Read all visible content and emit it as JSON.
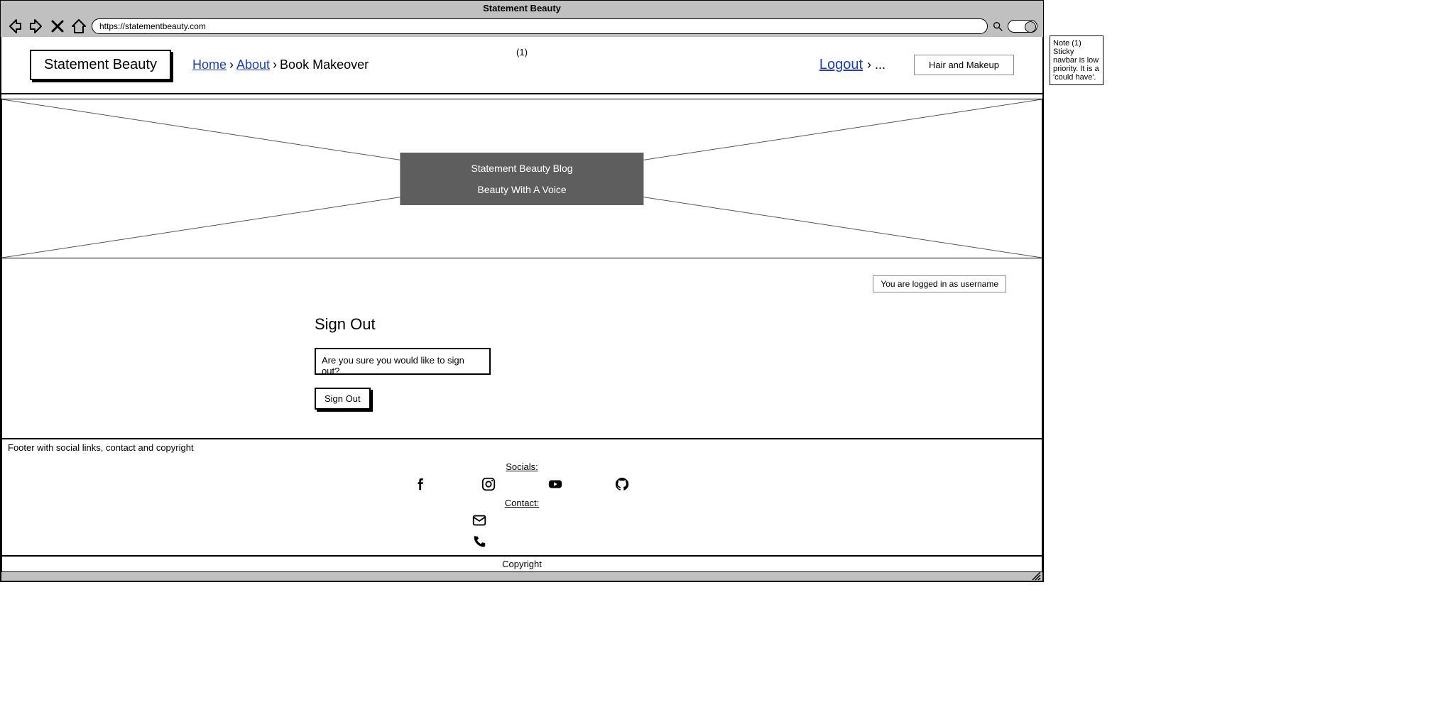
{
  "browser": {
    "title": "Statement Beauty",
    "url": "https://statementbeauty.com"
  },
  "navbar": {
    "brand": "Statement Beauty",
    "crumb_home": "Home",
    "crumb_about": "About",
    "crumb_book": "Book Makeover",
    "badge": "(1)",
    "logout": "Logout",
    "dots": "› ...",
    "hair_makeup": "Hair and Makeup"
  },
  "hero": {
    "line1": "Statement Beauty Blog",
    "line2": "Beauty With A Voice"
  },
  "content": {
    "login_status": "You are logged in as username",
    "signout_title": "Sign Out",
    "confirm_text": "Are you sure you would like to sign out?",
    "signout_button": "Sign Out"
  },
  "footer": {
    "heading": "Footer with social links, contact and copyright",
    "socials_label": "Socials:",
    "contact_label": "Contact:",
    "copyright": "Copyright"
  },
  "annotation": {
    "text": "Note (1) Sticky navbar is low priority. It is a 'could have'."
  }
}
